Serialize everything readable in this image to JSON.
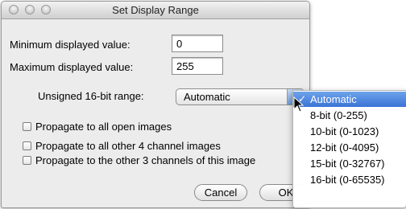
{
  "window": {
    "title": "Set Display Range",
    "traffic_lights": [
      "close-button",
      "minimize-button",
      "zoom-button"
    ]
  },
  "form": {
    "min_label": "Minimum displayed value:",
    "min_value": "0",
    "max_label": "Maximum displayed value:",
    "max_value": "255",
    "range_label": "Unsigned 16-bit range:",
    "range_selected": "Automatic"
  },
  "checkboxes": [
    {
      "label": "Propagate to all open images",
      "checked": false
    },
    {
      "label": "Propagate to all other 4 channel images",
      "checked": false
    },
    {
      "label": "Propagate to the other 3 channels of this image",
      "checked": false
    }
  ],
  "buttons": {
    "cancel": "Cancel",
    "ok": "OK"
  },
  "dropdown_menu": {
    "check_mark": "✓",
    "items": [
      "Automatic",
      "8-bit (0-255)",
      "10-bit (0-1023)",
      "12-bit (0-4095)",
      "15-bit (0-32767)",
      "16-bit (0-65535)"
    ],
    "selected_index": 0
  },
  "colors": {
    "menu_highlight": "#3b73d6",
    "window_bg": "#ececec"
  }
}
